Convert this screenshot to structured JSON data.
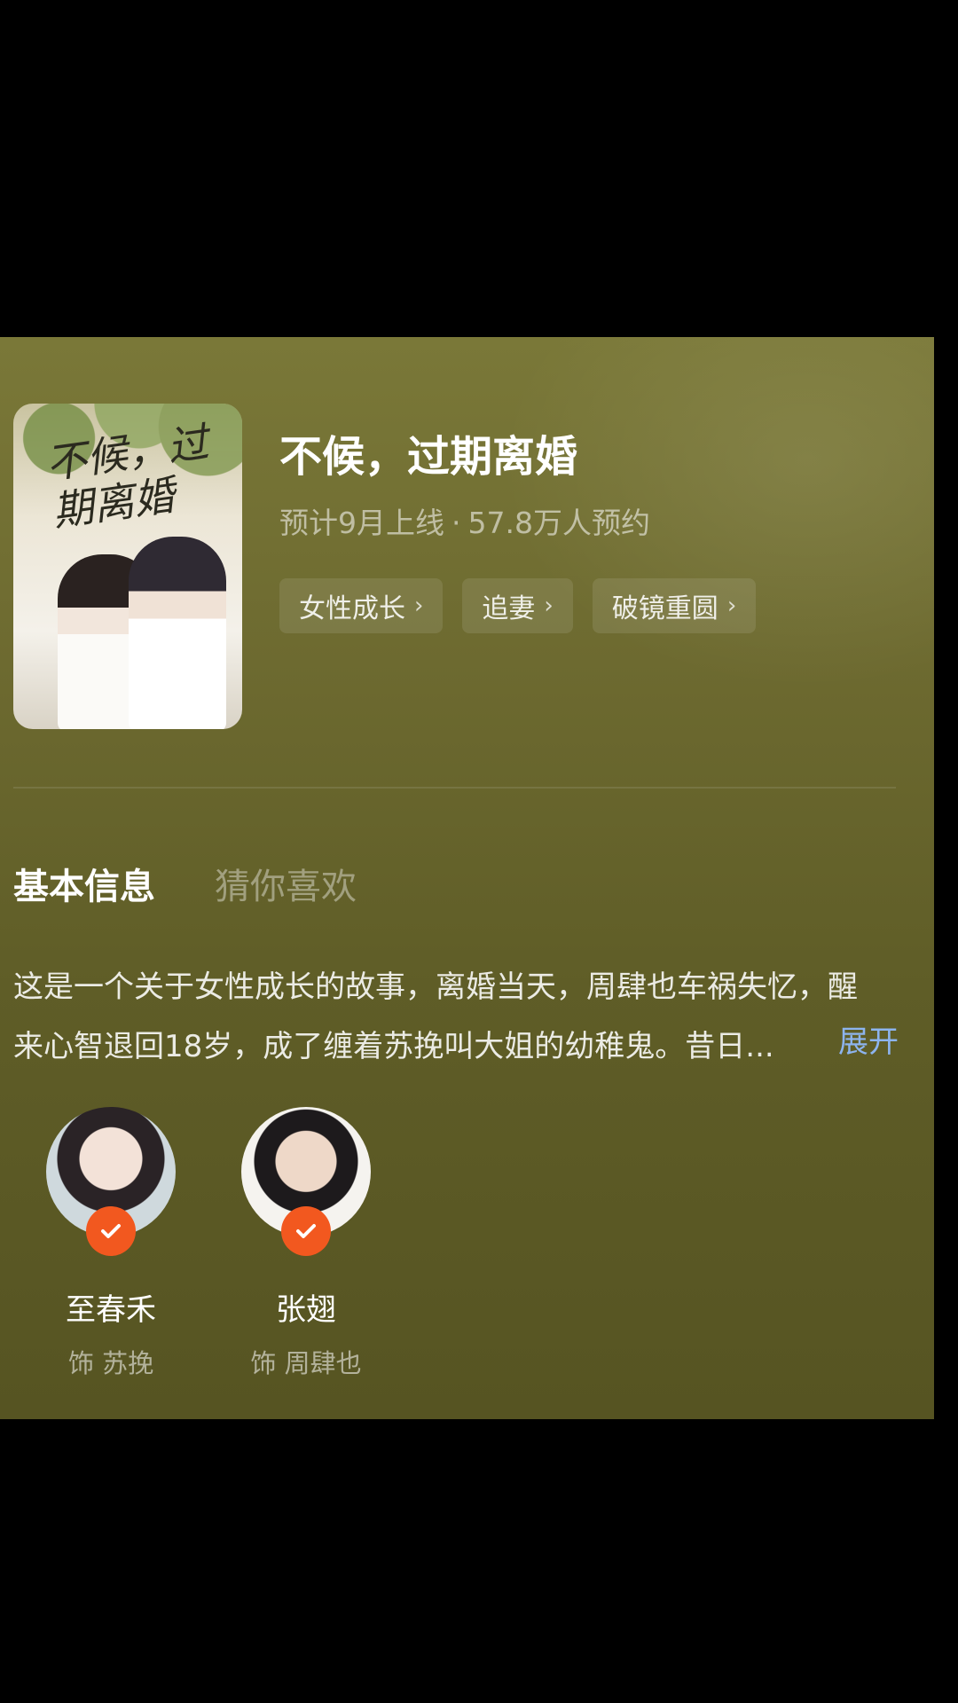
{
  "show": {
    "title": "不候，过期离婚",
    "release": "预计9月上线",
    "separator": "·",
    "reservations": "57.8万人预约",
    "poster_title": "不候，过期离婚",
    "tags": [
      {
        "label": "女性成长"
      },
      {
        "label": "追妻"
      },
      {
        "label": "破镜重圆"
      }
    ]
  },
  "tabs": [
    {
      "label": "基本信息",
      "active": true
    },
    {
      "label": "猜你喜欢",
      "active": false
    }
  ],
  "description": {
    "line1": "这是一个关于女性成长的故事，离婚当天，周肆也车祸失忆，醒",
    "line2": "来心智退回18岁，成了缠着苏挽叫大姐的幼稚鬼。昔日...",
    "expand_label": "展开"
  },
  "cast": [
    {
      "name": "至春禾",
      "role": "饰 苏挽"
    },
    {
      "name": "张翅",
      "role": "饰 周肆也"
    }
  ],
  "colors": {
    "panel": "#6d6a30",
    "accent": "#f2581f",
    "expand": "#8db4ee"
  },
  "icons": {
    "tag_chevron": "chevron-right-icon",
    "gallery": "gallery-icon",
    "verified": "check-icon"
  }
}
